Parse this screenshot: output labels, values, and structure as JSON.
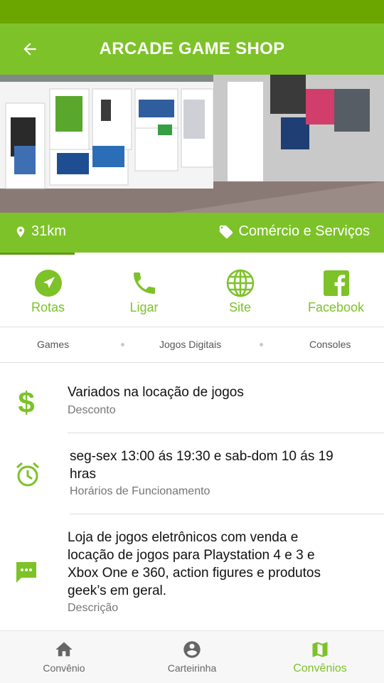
{
  "header": {
    "title": "ARCADE GAME SHOP"
  },
  "info": {
    "distance": "31km",
    "category": "Comércio e Serviços"
  },
  "actions": [
    {
      "label": "Rotas",
      "icon": "navigation-icon"
    },
    {
      "label": "Ligar",
      "icon": "phone-icon"
    },
    {
      "label": "Site",
      "icon": "globe-icon"
    },
    {
      "label": "Facebook",
      "icon": "facebook-icon"
    }
  ],
  "tags": [
    "Games",
    "Jogos Digitais",
    "Consoles"
  ],
  "details": {
    "discount": {
      "title": "Variados na locação de jogos",
      "label": "Desconto"
    },
    "hours": {
      "title_line1": "seg-sex 13:00 ás 19:30 e sab-dom 10 ás 19",
      "title_line2": "hras",
      "label": "Horários de Funcionamento"
    },
    "description": {
      "lines": [
        "Loja de jogos eletrônicos com venda e",
        "locação de jogos para Playstation 4 e 3 e",
        "Xbox One e 360, action figures e produtos",
        "geek’s em geral."
      ],
      "label": "Descrição"
    }
  },
  "bottom_nav": [
    {
      "label": "Convênio",
      "icon": "home-icon"
    },
    {
      "label": "Carteirinha",
      "icon": "account-icon"
    },
    {
      "label": "Convênios",
      "icon": "map-icon",
      "active": true
    }
  ],
  "colors": {
    "accent": "#7dc228",
    "status_bar": "#6aa500"
  }
}
